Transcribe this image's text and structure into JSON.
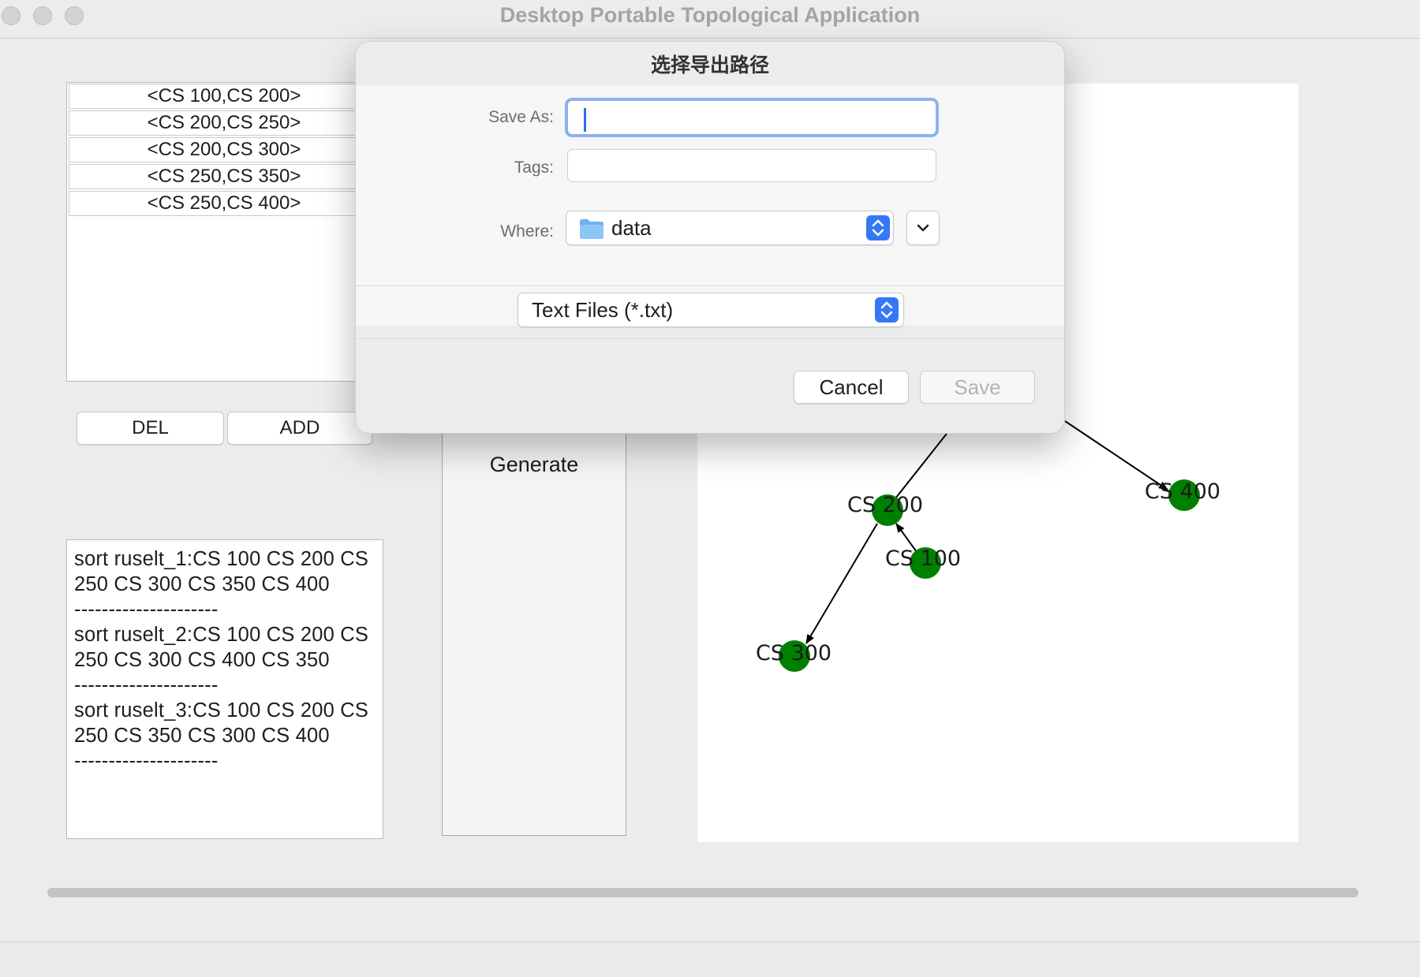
{
  "window": {
    "title": "Desktop Portable Topological Application"
  },
  "pairs": [
    "<CS 100,CS 200>",
    "<CS 200,CS 250>",
    "<CS 200,CS 300>",
    "<CS 250,CS 350>",
    "<CS 250,CS 400>"
  ],
  "buttons": {
    "del": "DEL",
    "add": "ADD",
    "generate": "Generate"
  },
  "results": {
    "text": "sort ruselt_1:CS 100 CS 200 CS 250 CS 300 CS 350 CS 400\n---------------------\nsort ruselt_2:CS 100 CS 200 CS 250 CS 300 CS 400 CS 350\n---------------------\nsort ruselt_3:CS 100 CS 200 CS 250 CS 350 CS 300 CS 400\n---------------------"
  },
  "graph": {
    "node_color": "#008000",
    "nodes": [
      {
        "id": "n400",
        "label": "CS 400"
      },
      {
        "id": "n200",
        "label": "CS 200"
      },
      {
        "id": "n100",
        "label": "CS 100"
      },
      {
        "id": "n300",
        "label": "CS 300"
      }
    ]
  },
  "dialog": {
    "title": "选择导出路径",
    "save_as_label": "Save As:",
    "save_as_value": "",
    "tags_label": "Tags:",
    "tags_value": "",
    "where_label": "Where:",
    "where_value": "data",
    "where_icon": "folder-icon",
    "file_type": "Text Files (*.txt)",
    "cancel": "Cancel",
    "save": "Save",
    "accent_color": "#3478f6"
  }
}
